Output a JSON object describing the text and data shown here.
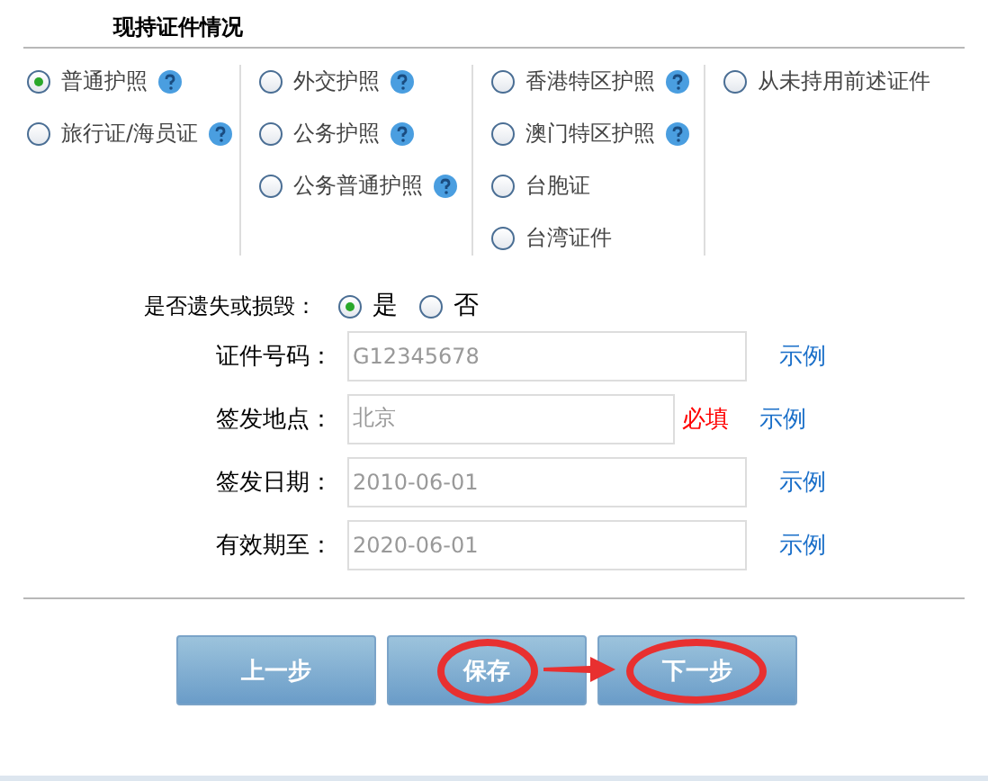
{
  "section_title": "现持证件情况",
  "document_columns": [
    [
      {
        "label": "普通护照",
        "selected": true,
        "help": true
      },
      {
        "label": "旅行证/海员证",
        "selected": false,
        "help": true
      }
    ],
    [
      {
        "label": "外交护照",
        "selected": false,
        "help": true
      },
      {
        "label": "公务护照",
        "selected": false,
        "help": true
      },
      {
        "label": "公务普通护照",
        "selected": false,
        "help": true
      }
    ],
    [
      {
        "label": "香港特区护照",
        "selected": false,
        "help": true
      },
      {
        "label": "澳门特区护照",
        "selected": false,
        "help": true
      },
      {
        "label": "台胞证",
        "selected": false,
        "help": false
      },
      {
        "label": "台湾证件",
        "selected": false,
        "help": false
      }
    ],
    [
      {
        "label": "从未持用前述证件",
        "selected": false,
        "help": false
      }
    ]
  ],
  "lost_question": {
    "label": "是否遗失或损毁：",
    "options": [
      {
        "label": "是",
        "selected": true
      },
      {
        "label": "否",
        "selected": false
      }
    ]
  },
  "fields": [
    {
      "label": "证件号码：",
      "value": "G12345678",
      "example": "示例"
    },
    {
      "label": "签发地点：",
      "value": "北京",
      "required_note": "必填",
      "example": "示例"
    },
    {
      "label": "签发日期：",
      "value": "2010-06-01",
      "example": "示例"
    },
    {
      "label": "有效期至：",
      "value": "2020-06-01",
      "example": "示例"
    }
  ],
  "buttons": [
    {
      "label": "上一步",
      "highlighted": false
    },
    {
      "label": "保存",
      "highlighted": true
    },
    {
      "label": "下一步",
      "highlighted": true
    }
  ],
  "annotation_arrow": true
}
